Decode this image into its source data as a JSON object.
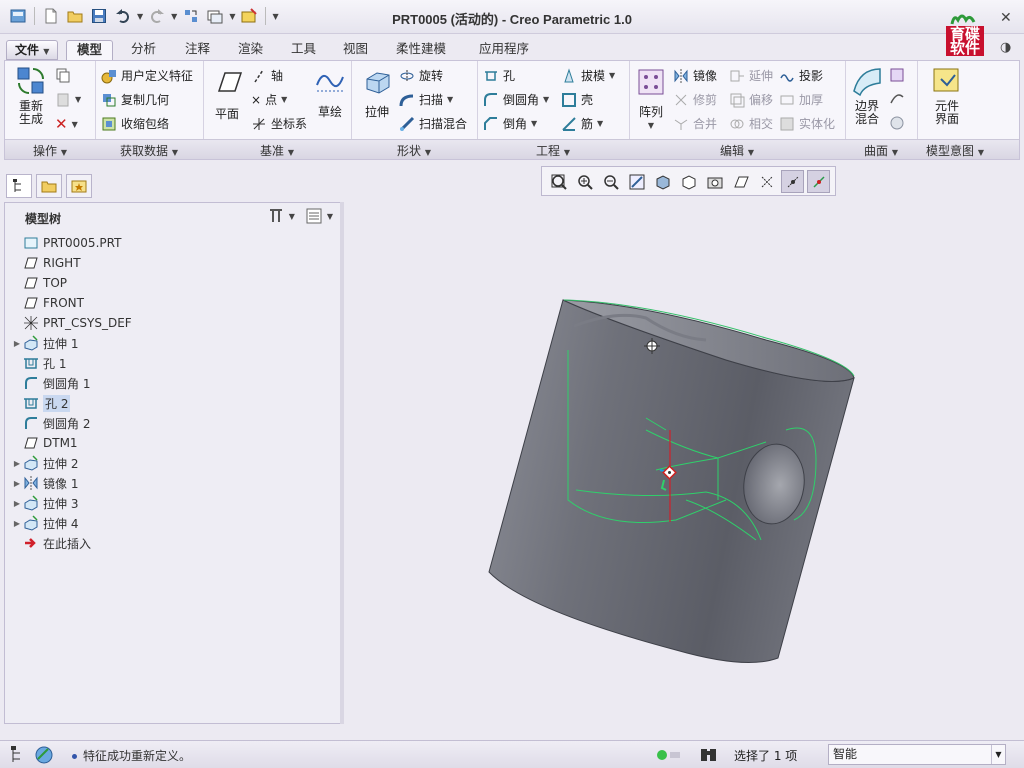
{
  "window": {
    "title": "PRT0005 (活动的) - Creo Parametric 1.0"
  },
  "logo": {
    "text": "育碟软件"
  },
  "tabs": [
    {
      "label": "模型"
    },
    {
      "label": "分析"
    },
    {
      "label": "注释"
    },
    {
      "label": "渲染"
    },
    {
      "label": "工具"
    },
    {
      "label": "视图"
    },
    {
      "label": "柔性建模"
    },
    {
      "label": "应用程序"
    }
  ],
  "file_menu": "文件",
  "ribbon": {
    "regen": "重新生成",
    "user_feature": "用户定义特征",
    "copy_geom": "复制几何",
    "shrinkwrap": "收缩包络",
    "plane": "平面",
    "axis": "轴",
    "point": "点",
    "csys": "坐标系",
    "sketch": "草绘",
    "extrude": "拉伸",
    "revolve": "旋转",
    "sweep": "扫描",
    "swept_blend": "扫描混合",
    "hole": "孔",
    "round": "倒圆角",
    "chamfer": "倒角",
    "draft": "拔模",
    "shell": "壳",
    "rib": "筋",
    "pattern": "阵列",
    "mirror": "镜像",
    "trim": "修剪",
    "merge": "合并",
    "extend": "延伸",
    "offset": "偏移",
    "intersect": "相交",
    "project": "投影",
    "thicken": "加厚",
    "solidify": "实体化",
    "boundary_blend": "边界混合",
    "component_interface": "元件界面",
    "groups": {
      "operations": "操作",
      "get_data": "获取数据",
      "datum": "基准",
      "shapes": "形状",
      "engineering": "工程",
      "editing": "编辑",
      "surfaces": "曲面",
      "model_intent": "模型意图"
    }
  },
  "tree": {
    "title": "模型树",
    "items": [
      {
        "label": "PRT0005.PRT",
        "icon": "part-icon",
        "expand": false
      },
      {
        "label": "RIGHT",
        "icon": "datum-plane-icon",
        "expand": false
      },
      {
        "label": "TOP",
        "icon": "datum-plane-icon",
        "expand": false
      },
      {
        "label": "FRONT",
        "icon": "datum-plane-icon",
        "expand": false
      },
      {
        "label": "PRT_CSYS_DEF",
        "icon": "csys-icon",
        "expand": false
      },
      {
        "label": "拉伸 1",
        "icon": "extrude-icon",
        "expand": true
      },
      {
        "label": "孔 1",
        "icon": "hole-icon",
        "expand": false
      },
      {
        "label": "倒圆角 1",
        "icon": "round-icon",
        "expand": false
      },
      {
        "label": "孔 2",
        "icon": "hole-icon",
        "expand": false,
        "selected": true
      },
      {
        "label": "倒圆角 2",
        "icon": "round-icon",
        "expand": false
      },
      {
        "label": "DTM1",
        "icon": "datum-plane-icon",
        "expand": false
      },
      {
        "label": "拉伸 2",
        "icon": "extrude-icon",
        "expand": true
      },
      {
        "label": "镜像 1",
        "icon": "mirror-icon",
        "expand": true
      },
      {
        "label": "拉伸 3",
        "icon": "extrude-icon",
        "expand": true
      },
      {
        "label": "拉伸 4",
        "icon": "extrude-icon",
        "expand": true
      },
      {
        "label": "在此插入",
        "icon": "insert-here-icon",
        "expand": false
      }
    ]
  },
  "status": {
    "message": "特征成功重新定义。",
    "selection": "选择了 1 项",
    "filter": "智能"
  },
  "colors": {
    "model": "#6e7078",
    "edge_highlight": "#2fd06b",
    "datum_axis": "#d0202a",
    "logo_red": "#c8102e"
  }
}
